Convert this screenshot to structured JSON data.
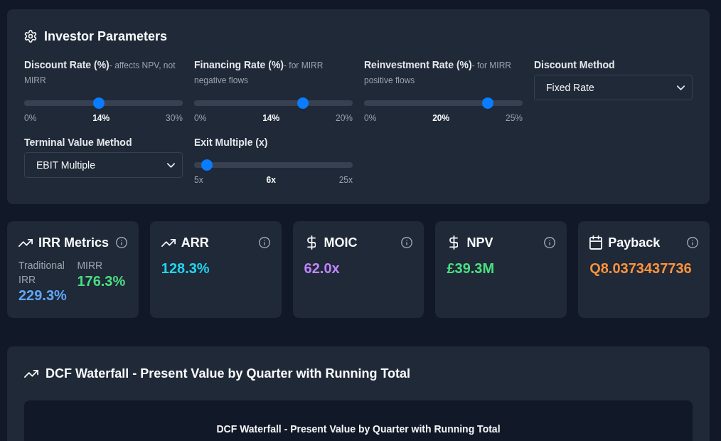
{
  "parameters": {
    "title": "Investor Parameters",
    "controls": [
      {
        "kind": "slider",
        "label": "Discount Rate (%)",
        "hint": "- affects NPV, not MIRR",
        "level": 0.467,
        "min_label": "0%",
        "value_label": "14%",
        "max_label": "30%"
      },
      {
        "kind": "slider",
        "label": "Financing Rate (%)",
        "hint": "- for MIRR negative flows",
        "level": 0.7,
        "min_label": "0%",
        "value_label": "14%",
        "max_label": "20%"
      },
      {
        "kind": "slider",
        "label": "Reinvestment Rate (%)",
        "hint": "- for MIRR positive flows",
        "level": 0.8,
        "min_label": "0%",
        "value_label": "20%",
        "max_label": "25%"
      },
      {
        "kind": "select",
        "label": "Discount Method",
        "value": "Fixed Rate"
      },
      {
        "kind": "select",
        "label": "Terminal Value Method",
        "value": "EBIT Multiple"
      },
      {
        "kind": "slider",
        "label": "Exit Multiple (x)",
        "level": 0.05,
        "min_label": "5x",
        "value_label": "6x",
        "max_label": "25x"
      }
    ]
  },
  "metrics": [
    {
      "kind": "dual",
      "title": "IRR Metrics",
      "values": [
        {
          "label": "Traditional IRR",
          "value": "229.3%",
          "color": "#60a5fa"
        },
        {
          "label": "MIRR",
          "value": "176.3%",
          "color": "#4ade80"
        }
      ]
    },
    {
      "kind": "single",
      "title": "ARR",
      "value": "128.3%",
      "color": "#22d3ee"
    },
    {
      "kind": "single",
      "title": "MOIC",
      "value": "62.0x",
      "color": "#c084fc"
    },
    {
      "kind": "single",
      "title": "NPV",
      "value": "£39.3M",
      "color": "#4ade80"
    },
    {
      "kind": "single",
      "title": "Payback",
      "value": "Q8.0373437736",
      "color": "#fb923c"
    }
  ],
  "chart_section": {
    "title": "DCF Waterfall - Present Value by Quarter with Running Total",
    "chart_title": "DCF Waterfall - Present Value by Quarter with Running Total"
  }
}
